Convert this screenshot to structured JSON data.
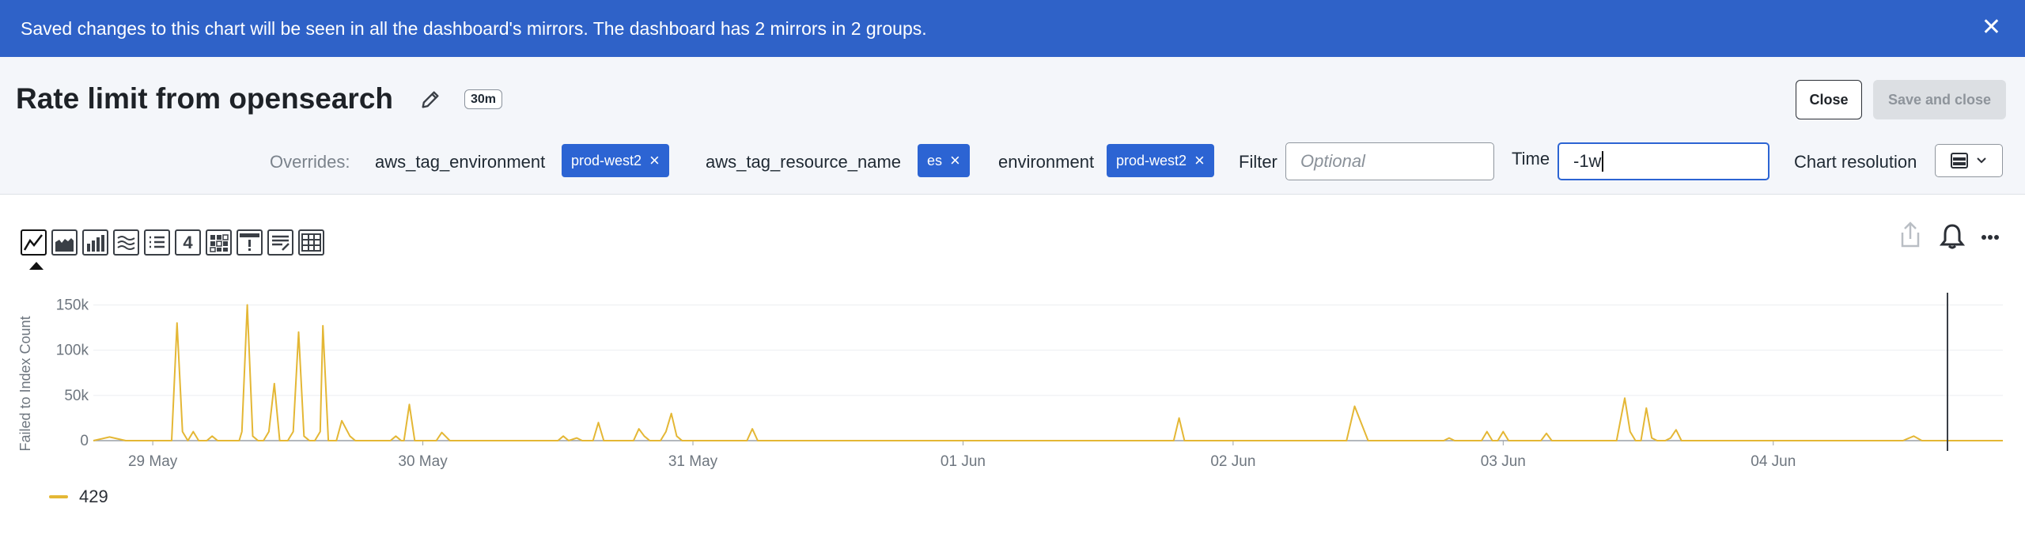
{
  "banner": {
    "message": "Saved changes to this chart will be seen in all the dashboard's mirrors. The dashboard has 2 mirrors in 2 groups.",
    "close_icon": "close-icon"
  },
  "header": {
    "title": "Rate limit from opensearch",
    "time_badge": "30m",
    "close_label": "Close",
    "save_close_label": "Save and close"
  },
  "overrides": {
    "label": "Overrides:",
    "items": [
      {
        "key": "aws_tag_environment",
        "value": "prod-west2"
      },
      {
        "key": "aws_tag_resource_name",
        "value": "es"
      },
      {
        "key": "environment",
        "value": "prod-west2"
      }
    ],
    "filter_label": "Filter",
    "filter_placeholder": "Optional",
    "time_label": "Time",
    "time_value": "-1w",
    "resolution_label": "Chart resolution"
  },
  "toolbar": {
    "tools": [
      "line-chart-icon",
      "area-chart-icon",
      "column-chart-icon",
      "histogram-icon",
      "list-icon",
      "single-value-icon",
      "heatmap-icon",
      "event-feed-icon",
      "text-note-icon",
      "table-icon"
    ],
    "single_value_label": "4"
  },
  "colors": {
    "banner": "#2f62c8",
    "pill": "#2c64d3",
    "series": "#e4b735"
  },
  "chart_data": {
    "type": "line",
    "ylabel": "Failed to Index Count",
    "y_ticks": [
      "0",
      "50k",
      "100k",
      "150k"
    ],
    "ylim": [
      0,
      160000
    ],
    "x_ticks": [
      "29 May",
      "30 May",
      "31 May",
      "01 Jun",
      "02 Jun",
      "03 Jun",
      "04 Jun"
    ],
    "x_range_days": [
      -0.22,
      6.85
    ],
    "grid": true,
    "legend_position": "bottom-left",
    "series": [
      {
        "name": "429",
        "color": "#e4b735",
        "points": [
          [
            -0.22,
            0
          ],
          [
            -0.16,
            4000
          ],
          [
            -0.1,
            0
          ],
          [
            -0.05,
            0
          ],
          [
            0.0,
            0
          ],
          [
            0.05,
            0
          ],
          [
            0.07,
            0
          ],
          [
            0.09,
            130000
          ],
          [
            0.11,
            10000
          ],
          [
            0.13,
            0
          ],
          [
            0.15,
            10000
          ],
          [
            0.17,
            0
          ],
          [
            0.2,
            0
          ],
          [
            0.22,
            5000
          ],
          [
            0.24,
            0
          ],
          [
            0.28,
            0
          ],
          [
            0.32,
            0
          ],
          [
            0.33,
            10000
          ],
          [
            0.35,
            150000
          ],
          [
            0.37,
            5000
          ],
          [
            0.39,
            0
          ],
          [
            0.41,
            0
          ],
          [
            0.43,
            10000
          ],
          [
            0.45,
            63000
          ],
          [
            0.47,
            0
          ],
          [
            0.5,
            0
          ],
          [
            0.52,
            10000
          ],
          [
            0.54,
            120000
          ],
          [
            0.56,
            5000
          ],
          [
            0.58,
            0
          ],
          [
            0.6,
            0
          ],
          [
            0.62,
            10000
          ],
          [
            0.63,
            127000
          ],
          [
            0.65,
            0
          ],
          [
            0.68,
            0
          ],
          [
            0.7,
            22000
          ],
          [
            0.73,
            5000
          ],
          [
            0.75,
            0
          ],
          [
            0.88,
            0
          ],
          [
            0.9,
            5000
          ],
          [
            0.92,
            0
          ],
          [
            0.93,
            0
          ],
          [
            0.95,
            40000
          ],
          [
            0.97,
            0
          ],
          [
            1.05,
            0
          ],
          [
            1.07,
            9000
          ],
          [
            1.1,
            0
          ],
          [
            1.5,
            0
          ],
          [
            1.52,
            5000
          ],
          [
            1.54,
            0
          ],
          [
            1.57,
            3000
          ],
          [
            1.59,
            0
          ],
          [
            1.63,
            0
          ],
          [
            1.65,
            20000
          ],
          [
            1.67,
            0
          ],
          [
            1.78,
            0
          ],
          [
            1.8,
            13000
          ],
          [
            1.82,
            5000
          ],
          [
            1.84,
            0
          ],
          [
            1.88,
            0
          ],
          [
            1.9,
            10000
          ],
          [
            1.92,
            30000
          ],
          [
            1.94,
            5000
          ],
          [
            1.96,
            0
          ],
          [
            2.2,
            0
          ],
          [
            2.22,
            13000
          ],
          [
            2.24,
            0
          ],
          [
            3.78,
            0
          ],
          [
            3.8,
            25000
          ],
          [
            3.82,
            0
          ],
          [
            4.42,
            0
          ],
          [
            4.45,
            38000
          ],
          [
            4.5,
            0
          ],
          [
            4.78,
            0
          ],
          [
            4.8,
            3000
          ],
          [
            4.82,
            0
          ],
          [
            4.92,
            0
          ],
          [
            4.94,
            10000
          ],
          [
            4.96,
            0
          ],
          [
            4.98,
            0
          ],
          [
            5.0,
            10000
          ],
          [
            5.02,
            0
          ],
          [
            5.14,
            0
          ],
          [
            5.16,
            8000
          ],
          [
            5.18,
            0
          ],
          [
            5.42,
            0
          ],
          [
            5.45,
            47000
          ],
          [
            5.47,
            10000
          ],
          [
            5.49,
            0
          ],
          [
            5.51,
            0
          ],
          [
            5.53,
            36000
          ],
          [
            5.55,
            3000
          ],
          [
            5.57,
            0
          ],
          [
            5.6,
            0
          ],
          [
            5.62,
            3000
          ],
          [
            5.64,
            12000
          ],
          [
            5.66,
            0
          ],
          [
            6.48,
            0
          ],
          [
            6.52,
            5000
          ],
          [
            6.55,
            0
          ],
          [
            6.85,
            0
          ]
        ]
      }
    ]
  }
}
